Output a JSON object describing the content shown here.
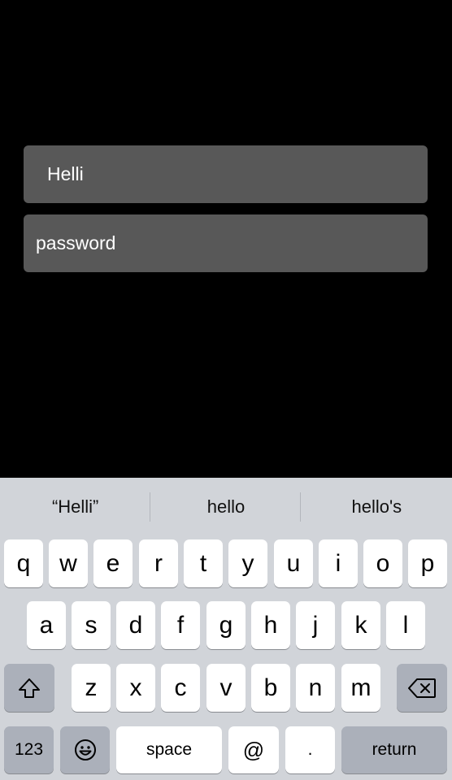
{
  "form": {
    "username_value": "Helli",
    "password_placeholder": "password"
  },
  "keyboard": {
    "suggestions": [
      "“Helli”",
      "hello",
      "hello's"
    ],
    "row1": [
      "q",
      "w",
      "e",
      "r",
      "t",
      "y",
      "u",
      "i",
      "o",
      "p"
    ],
    "row2": [
      "a",
      "s",
      "d",
      "f",
      "g",
      "h",
      "j",
      "k",
      "l"
    ],
    "row3": [
      "z",
      "x",
      "c",
      "v",
      "b",
      "n",
      "m"
    ],
    "numbers_label": "123",
    "space_label": "space",
    "at_label": "@",
    "period_label": ".",
    "return_label": "return",
    "icons": {
      "shift": "shift-icon",
      "backspace": "backspace-icon",
      "emoji": "emoji-icon"
    }
  }
}
